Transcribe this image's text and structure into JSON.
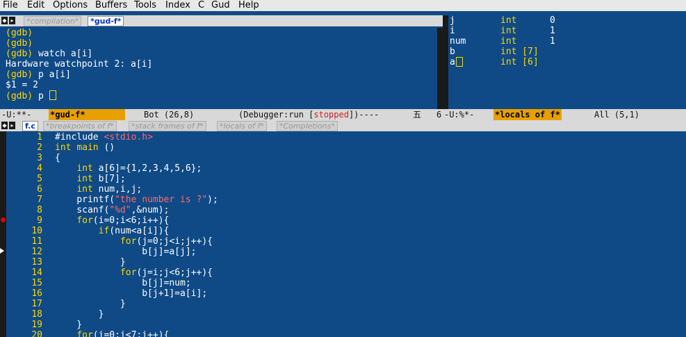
{
  "menubar": {
    "items": [
      "File",
      "Edit",
      "Options",
      "Buffers",
      "Tools",
      "Index",
      "C",
      "Gud",
      "Help"
    ]
  },
  "top_header": {
    "tabs": [
      "*compilation*",
      "*gud-f*"
    ]
  },
  "gud_console": {
    "lines": [
      {
        "prompt": "(gdb)",
        "text": ""
      },
      {
        "prompt": "(gdb)",
        "text": ""
      },
      {
        "prompt": "(gdb)",
        "text": " watch a[i]"
      },
      {
        "prompt": "",
        "text": "Hardware watchpoint 2: a[i]"
      },
      {
        "prompt": "(gdb)",
        "text": " p a[i]"
      },
      {
        "prompt": "",
        "text": "$1 = 2"
      },
      {
        "prompt": "(gdb)",
        "text": " p "
      }
    ]
  },
  "locals_panel": {
    "rows": [
      {
        "name": "j",
        "type": "int",
        "value": "0"
      },
      {
        "name": "i",
        "type": "int",
        "value": "1"
      },
      {
        "name": "num",
        "type": "int",
        "value": "1"
      },
      {
        "name": "b",
        "type": "int [7]",
        "value": ""
      },
      {
        "name": "a",
        "type": "int [6]",
        "value": ""
      }
    ]
  },
  "modeline_left": {
    "status": "-U:**-",
    "buffer": "*gud-f*",
    "position": "Bot (26,8)",
    "mode_prefix": "(Debugger:run [",
    "mode_state": "stopped",
    "mode_suffix": "])----",
    "glyph": "五",
    "tail": "6"
  },
  "modeline_right": {
    "status": "-U:%*-",
    "buffer": "*locals of f*",
    "position": "All (5,1)"
  },
  "source_header": {
    "tabs": [
      "f.c",
      "*breakpoints of f*",
      "*stack frames of f*",
      "*locals of f*",
      "*Completions*"
    ]
  },
  "source": {
    "lines": [
      {
        "n": "1",
        "code": "#include <stdio.h>"
      },
      {
        "n": "2",
        "code": "int main ()"
      },
      {
        "n": "3",
        "code": "{"
      },
      {
        "n": "4",
        "code": "    int a[6]={1,2,3,4,5,6};"
      },
      {
        "n": "5",
        "code": "    int b[7];"
      },
      {
        "n": "6",
        "code": "    int num,i,j;"
      },
      {
        "n": "7",
        "code": "    printf(\"the number is ?\");"
      },
      {
        "n": "8",
        "code": "    scanf(\"%d\",&num);"
      },
      {
        "n": "9",
        "code": "    for(i=0;i<6;i++){"
      },
      {
        "n": "10",
        "code": "        if(num<a[i]){"
      },
      {
        "n": "11",
        "code": "            for(j=0;j<i;j++){"
      },
      {
        "n": "12",
        "code": "                b[j]=a[j];"
      },
      {
        "n": "13",
        "code": "            }"
      },
      {
        "n": "14",
        "code": "            for(j=i;j<6;j++){"
      },
      {
        "n": "15",
        "code": "                b[j]=num;"
      },
      {
        "n": "16",
        "code": "                b[j+1]=a[i];"
      },
      {
        "n": "17",
        "code": "            }"
      },
      {
        "n": "18",
        "code": "        }"
      },
      {
        "n": "19",
        "code": "    }"
      },
      {
        "n": "20",
        "code": "    for(i=0;i<7;i++){"
      }
    ]
  },
  "colors": {
    "background": "#0f4a86",
    "keyword": "#ffd700",
    "string": "#ff6a6a",
    "buffer_highlight": "#e8a000",
    "breakpoint": "#e00000"
  },
  "icons": {
    "breakpoint": "breakpoint-dot-icon",
    "current_line": "current-line-arrow-icon",
    "header_nav": "header-nav-icon"
  }
}
